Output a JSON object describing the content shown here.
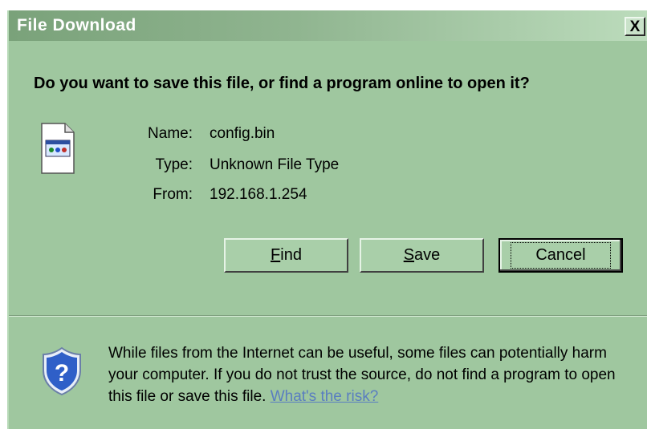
{
  "dialog": {
    "title": "File Download",
    "close_label": "X",
    "question": "Do you want to save this file, or find a program online to open it?"
  },
  "file": {
    "name_label": "Name:",
    "name_value": "config.bin",
    "type_label": "Type:",
    "type_value": "Unknown File Type",
    "from_label": "From:",
    "from_value": "192.168.1.254",
    "icon": "file-icon"
  },
  "buttons": {
    "find_mnemonic": "F",
    "find_rest": "ind",
    "save_mnemonic": "S",
    "save_rest": "ave",
    "cancel": "Cancel"
  },
  "warning": {
    "text": "While files from the Internet can be useful, some files can potentially harm your computer. If you do not trust the source, do not find a program to open this file or save this file.",
    "link": "What's the risk?",
    "icon": "shield-question-icon"
  },
  "colors": {
    "window_bg": "#9fc79f",
    "title_text": "#ffffff",
    "link": "#5a7ec0"
  }
}
